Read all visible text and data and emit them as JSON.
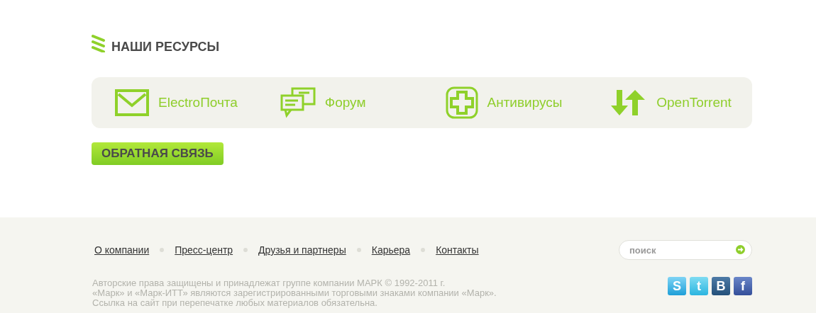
{
  "resources": {
    "title": "НАШИ РЕСУРСЫ",
    "items": [
      {
        "kind": "mail",
        "label": "ElectroПочта"
      },
      {
        "kind": "chat",
        "label": "Форум"
      },
      {
        "kind": "plus",
        "label": "Антивирусы"
      },
      {
        "kind": "arrows",
        "label": "OpenTorrent"
      }
    ]
  },
  "feedback_button": "ОБРАТНАЯ СВЯЗЬ",
  "footer": {
    "links": [
      "О компании",
      "Пресс-центр",
      "Друзья и партнеры",
      "Карьера",
      "Контакты"
    ],
    "search": {
      "placeholder": "поиск"
    },
    "copyright": [
      "Авторские права защищены и принадлежат группе компании МАРК © 1992-2011 г.",
      "«Марк» и «Марк-ИТТ» являются зарегистрированными торговыми знаками компании «Марк».",
      "Ссылка на сайт при перепечатке любых материалов обязательна."
    ],
    "social": [
      {
        "kind": "skype",
        "glyph": "S"
      },
      {
        "kind": "twitter",
        "glyph": "t"
      },
      {
        "kind": "vk",
        "glyph": "B"
      },
      {
        "kind": "facebook",
        "glyph": "f"
      }
    ]
  }
}
